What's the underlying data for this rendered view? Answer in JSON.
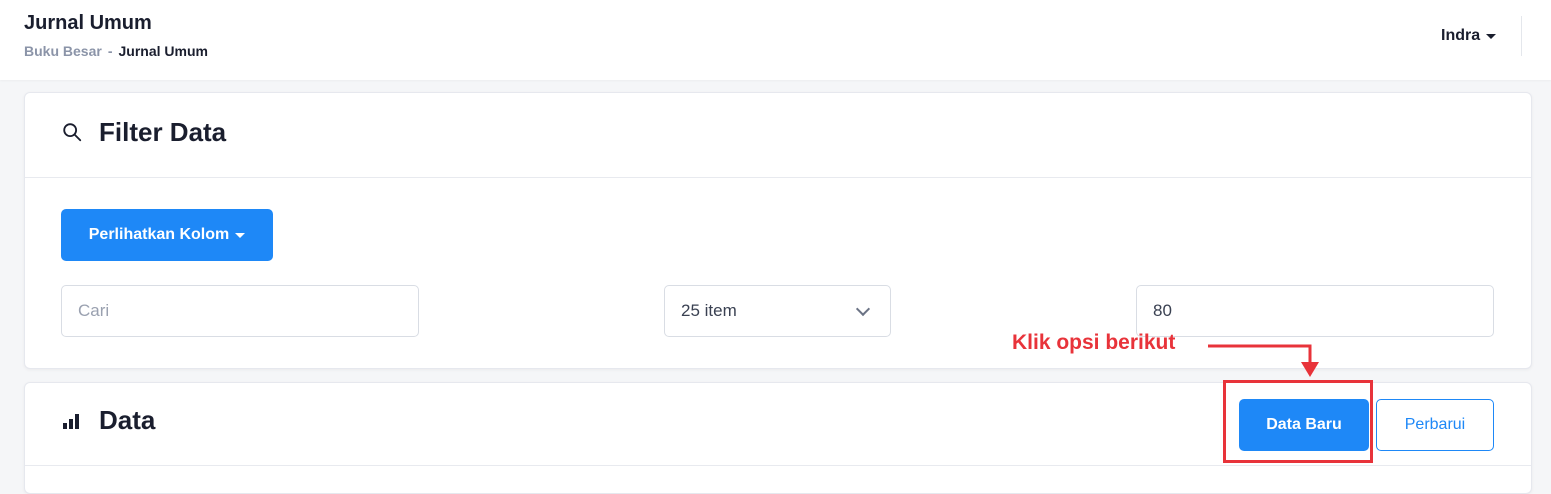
{
  "header": {
    "title": "Jurnal Umum",
    "breadcrumb": {
      "parent": "Buku Besar",
      "separator": "-",
      "current": "Jurnal Umum"
    },
    "user": "Indra"
  },
  "filter": {
    "title": "Filter Data",
    "icon": "search-icon",
    "columns_button": "Perlihatkan Kolom",
    "search_placeholder": "Cari",
    "per_page": "25 item",
    "number_value": "80"
  },
  "data_section": {
    "title": "Data",
    "icon": "bar-chart-icon",
    "new_button": "Data Baru",
    "refresh_button": "Perbarui"
  },
  "annotation": {
    "text": "Klik opsi berikut",
    "color": "#e8333a"
  },
  "colors": {
    "primary": "#1e88f7",
    "annotation": "#e8333a"
  }
}
